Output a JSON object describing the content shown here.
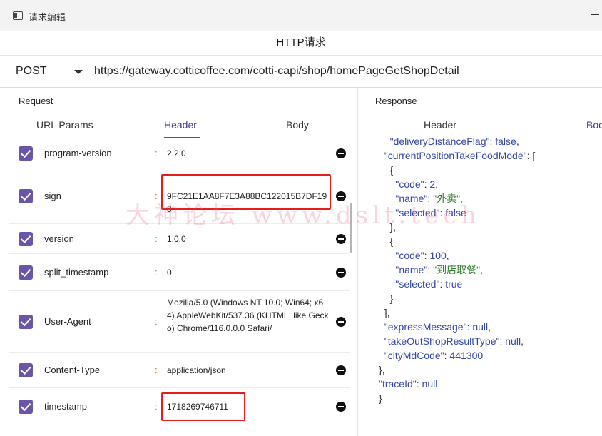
{
  "window": {
    "title": "请求编辑"
  },
  "dialog": {
    "title": "HTTP请求"
  },
  "request_line": {
    "method": "POST",
    "url": "https://gateway.cotticoffee.com/cotti-capi/shop/homePageGetShopDetail"
  },
  "request": {
    "label": "Request",
    "tabs": [
      "URL Params",
      "Header",
      "Body"
    ],
    "active_tab": "Header",
    "headers": [
      {
        "key": "program-version",
        "value": "2.2.0",
        "checked": true
      },
      {
        "key": "sign",
        "value": "9FC21E1AA8F7E3A88BC122015B7DF198",
        "checked": true,
        "highlighted": true
      },
      {
        "key": "version",
        "value": "1.0.0",
        "checked": true
      },
      {
        "key": "split_timestamp",
        "value": "0",
        "checked": true
      },
      {
        "key": "User-Agent",
        "value": "Mozilla/5.0 (Windows NT 10.0; Win64; x64) AppleWebKit/537.36 (KHTML, like Gecko) Chrome/116.0.0.0 Safari/",
        "checked": true
      },
      {
        "key": "Content-Type",
        "value": "application/json",
        "checked": true
      },
      {
        "key": "timestamp",
        "value": "1718269746711",
        "checked": true,
        "highlighted": true
      }
    ]
  },
  "response": {
    "label": "Response",
    "tabs": [
      "Header",
      "Body"
    ],
    "active_tab": "Body",
    "json_lines": [
      [
        "    ",
        "k:\"deliveryDistanceFlag\"",
        ": ",
        "kw:false",
        ","
      ],
      [
        "  ",
        "k:\"currentPositionTakeFoodMode\"",
        ": ["
      ],
      [
        "    {"
      ],
      [
        "      ",
        "k:\"code\"",
        ": ",
        "n:2",
        ","
      ],
      [
        "      ",
        "k:\"name\"",
        ": ",
        "s:\"外卖\"",
        ","
      ],
      [
        "      ",
        "k:\"selected\"",
        ": ",
        "kw:false"
      ],
      [
        "    },"
      ],
      [
        "    {"
      ],
      [
        "      ",
        "k:\"code\"",
        ": ",
        "n:100",
        ","
      ],
      [
        "      ",
        "k:\"name\"",
        ": ",
        "s:\"到店取餐\"",
        ","
      ],
      [
        "      ",
        "k:\"selected\"",
        ": ",
        "kw:true"
      ],
      [
        "    }"
      ],
      [
        "  ],"
      ],
      [
        "  ",
        "k:\"expressMessage\"",
        ": ",
        "kw:null",
        ","
      ],
      [
        "  ",
        "k:\"takeOutShopResultType\"",
        ": ",
        "kw:null",
        ","
      ],
      [
        "  ",
        "k:\"cityMdCode\"",
        ": ",
        "n:441300"
      ],
      [
        "},"
      ],
      [
        "",
        "k:\"traceId\"",
        ": ",
        "kw:null"
      ],
      [
        "}"
      ]
    ]
  },
  "watermark": "大神论坛  www.dslt.tech"
}
